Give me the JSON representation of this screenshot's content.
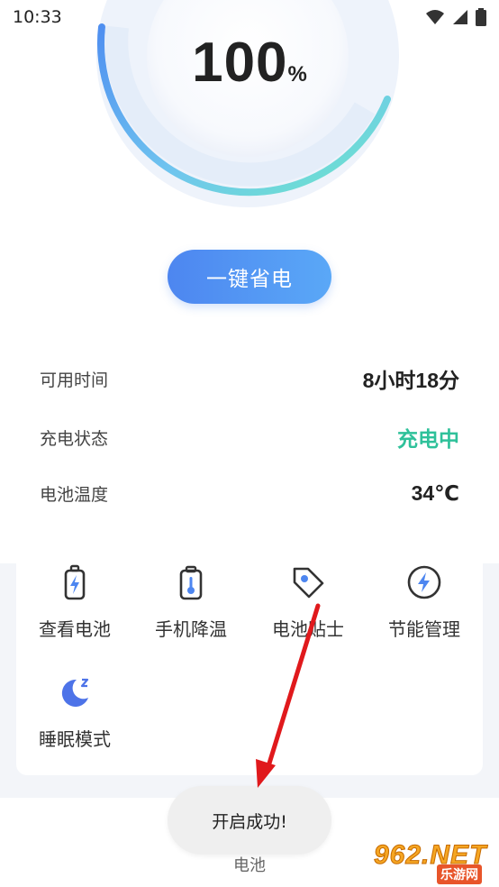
{
  "status_bar": {
    "time": "10:33"
  },
  "gauge": {
    "value": "100",
    "unit": "%",
    "level_percent": 100
  },
  "save_button": {
    "label": "一键省电"
  },
  "info": [
    {
      "label": "可用时间",
      "value": "8小时18分"
    },
    {
      "label": "充电状态",
      "value": "充电中"
    },
    {
      "label": "电池温度",
      "value": "34℃"
    }
  ],
  "tools": [
    {
      "label": "查看电池",
      "icon": "battery-charging-icon"
    },
    {
      "label": "手机降温",
      "icon": "thermometer-battery-icon"
    },
    {
      "label": "电池贴士",
      "icon": "tag-icon"
    },
    {
      "label": "节能管理",
      "icon": "lightning-circle-icon"
    },
    {
      "label": "睡眠模式",
      "icon": "moon-sleep-icon"
    }
  ],
  "tabbar": {
    "label": "电池"
  },
  "toast": {
    "text": "开启成功!"
  },
  "watermark": {
    "main": "962.NET",
    "sub": "乐游网"
  },
  "colors": {
    "accent_blue": "#4d86f0",
    "accent_green": "#2fc19a",
    "annotation_red": "#e0191c"
  }
}
